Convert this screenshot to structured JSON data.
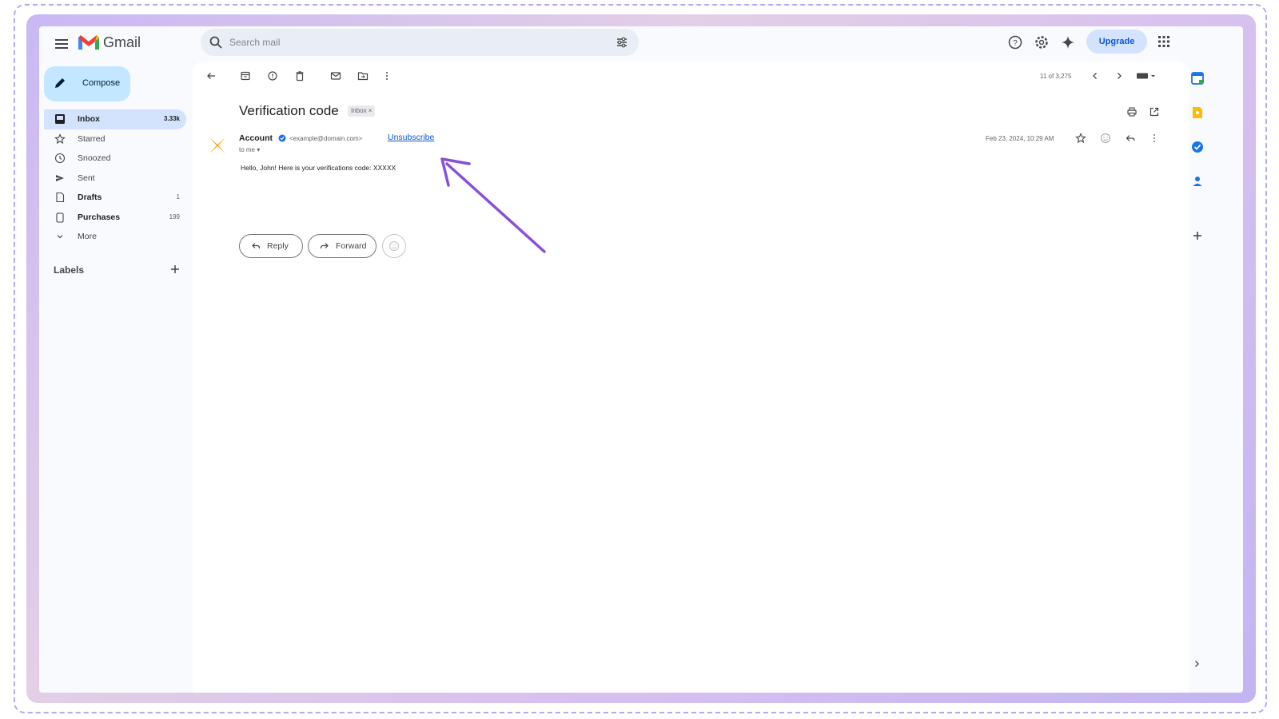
{
  "header": {
    "app_name": "Gmail",
    "search_placeholder": "Search mail",
    "upgrade_label": "Upgrade"
  },
  "sidebar": {
    "compose_label": "Compose",
    "items": [
      {
        "label": "Inbox",
        "count": "3.33k",
        "icon": "inbox-icon",
        "active": true,
        "bold": true
      },
      {
        "label": "Starred",
        "count": "",
        "icon": "star-icon",
        "active": false,
        "bold": false
      },
      {
        "label": "Snoozed",
        "count": "",
        "icon": "clock-icon",
        "active": false,
        "bold": false
      },
      {
        "label": "Sent",
        "count": "",
        "icon": "send-icon",
        "active": false,
        "bold": false
      },
      {
        "label": "Drafts",
        "count": "1",
        "icon": "draft-icon",
        "active": false,
        "bold": true
      },
      {
        "label": "Purchases",
        "count": "199",
        "icon": "tag-icon",
        "active": false,
        "bold": true
      },
      {
        "label": "More",
        "count": "",
        "icon": "chevron-down-icon",
        "active": false,
        "bold": false
      }
    ],
    "labels_title": "Labels"
  },
  "toolbar": {
    "pager": "11 of 3,275"
  },
  "email": {
    "subject": "Verification code",
    "inbox_chip": "Inbox ×",
    "sender_name": "Account",
    "sender_email": "<example@domain.com>",
    "unsubscribe_label": "Unsubscribe",
    "to_me": "to me ▾",
    "date": "Feb 23, 2024, 10:29 AM",
    "body": "Hello, John! Here is your verifications code: XXXXX"
  },
  "actions": {
    "reply_label": "Reply",
    "forward_label": "Forward"
  },
  "colors": {
    "accent": "#0b57d0",
    "compose_bg": "#c2e7ff",
    "annotation_arrow": "#8a4fd8",
    "avatar": "#f0a020"
  }
}
